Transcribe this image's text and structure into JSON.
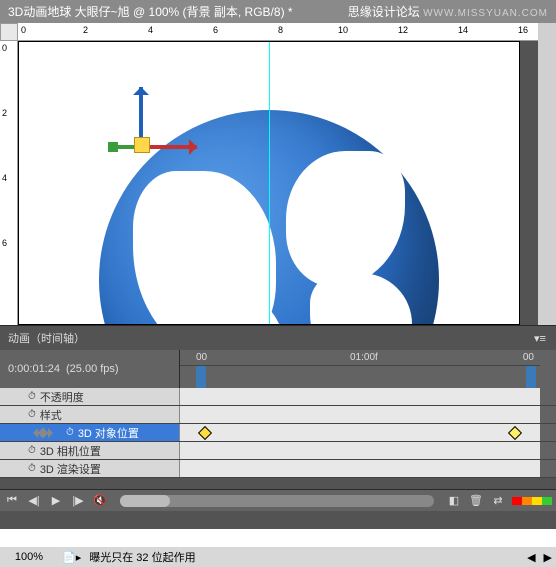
{
  "titlebar": {
    "doc_title": "3D动画地球   大眼仔~旭 @ 100% (背景 副本, RGB/8) *",
    "forum": "思缘设计论坛",
    "watermark": "WWW.MISSYUAN.COM"
  },
  "rulers": {
    "h": [
      "0",
      "2",
      "4",
      "6",
      "8",
      "10",
      "12",
      "14",
      "16"
    ],
    "v": [
      "0",
      "2",
      "4",
      "6"
    ]
  },
  "animation": {
    "panel_title": "动画（时间轴）",
    "current_time": "0:00:01:24",
    "fps": "(25.00 fps)",
    "timeline_marks": {
      "start": "00",
      "mid": "01:00f",
      "end": "00"
    },
    "tracks": [
      {
        "label": "不透明度",
        "selected": false
      },
      {
        "label": "样式",
        "selected": false
      },
      {
        "label": "3D 对象位置",
        "selected": true,
        "keyframes": [
          20,
          330
        ]
      },
      {
        "label": "3D 相机位置",
        "selected": false
      },
      {
        "label": "3D 渲染设置",
        "selected": false
      }
    ]
  },
  "statusbar": {
    "zoom": "100%",
    "message": "曝光只在 32 位起作用"
  }
}
